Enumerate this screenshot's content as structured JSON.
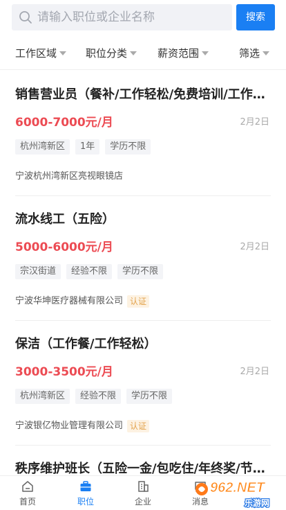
{
  "search": {
    "placeholder": "请输入职位或企业名称",
    "button_label": "搜索"
  },
  "filters": [
    {
      "label": "工作区域"
    },
    {
      "label": "职位分类"
    },
    {
      "label": "薪资范围"
    },
    {
      "label": "筛选"
    }
  ],
  "jobs": [
    {
      "title": "销售营业员（餐补/工作轻松/免费培训/工作轻松）",
      "salary": "6000-7000元/月",
      "date": "2月2日",
      "tags": [
        "杭州湾新区",
        "1年",
        "学历不限"
      ],
      "company": "宁波杭州湾新区亮视眼镜店",
      "verified": ""
    },
    {
      "title": "流水线工（五险）",
      "salary": "5000-6000元/月",
      "date": "2月2日",
      "tags": [
        "宗汉街道",
        "经验不限",
        "学历不限"
      ],
      "company": "宁波华坤医疗器械有限公司",
      "verified": "认证"
    },
    {
      "title": "保洁（工作餐/工作轻松）",
      "salary": "3000-3500元/月",
      "date": "2月2日",
      "tags": [
        "杭州湾新区",
        "经验不限",
        "学历不限"
      ],
      "company": "宁波银亿物业管理有限公司",
      "verified": "认证"
    },
    {
      "title": "秩序维护班长（五险一金/包吃住/年终奖/节日福利）"
    }
  ],
  "bottom_nav": [
    {
      "label": "首页",
      "icon": "home-icon"
    },
    {
      "label": "职位",
      "icon": "briefcase-icon",
      "active": true
    },
    {
      "label": "企业",
      "icon": "building-icon"
    },
    {
      "label": "消息",
      "icon": "message-icon"
    }
  ],
  "watermark": {
    "brand": "962.NET",
    "site": "乐游网"
  },
  "colors": {
    "accent": "#1a7ff3",
    "salary": "#ec4b53",
    "verified_bg": "#fdf2e2",
    "verified_text": "#e3a34d"
  }
}
